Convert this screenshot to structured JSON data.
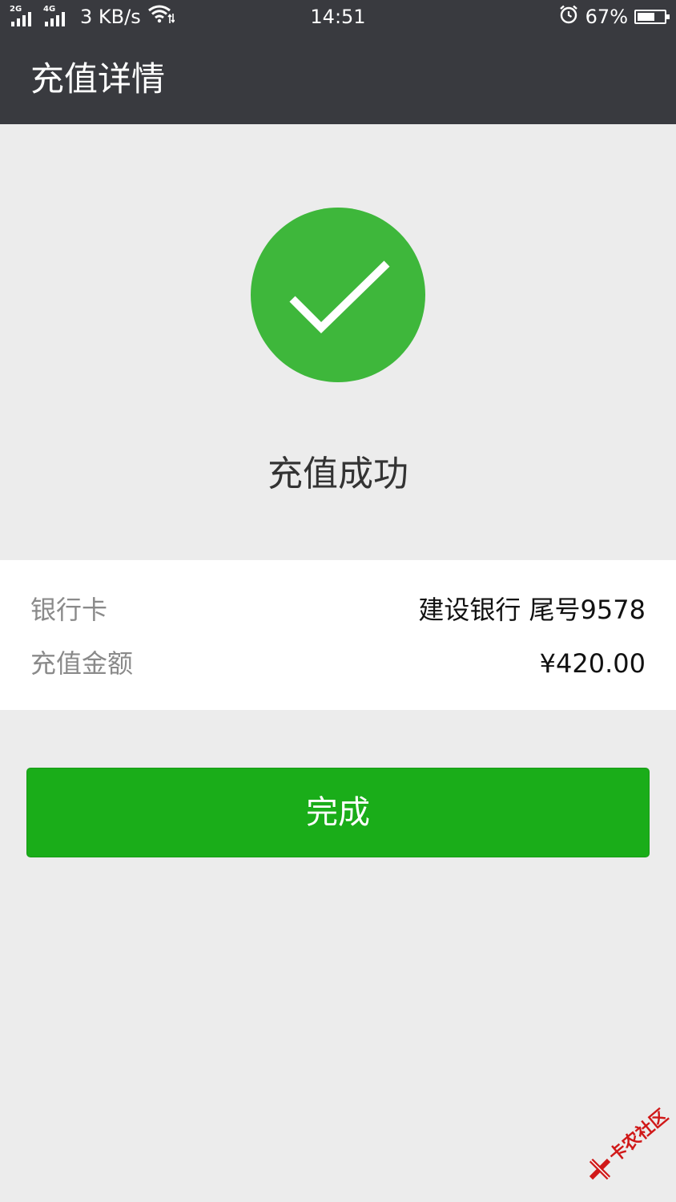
{
  "status_bar": {
    "sim1_type": "2G",
    "sim2_type": "4G",
    "net_speed": "3 KB/s",
    "time": "14:51",
    "battery_percent": "67%",
    "battery_level": 0.67,
    "icons": [
      "signal-icon",
      "wifi-icon",
      "alarm-icon",
      "battery-icon"
    ]
  },
  "header": {
    "title": "充值详情"
  },
  "result": {
    "status_text": "充值成功",
    "icon": "check-icon",
    "icon_color": "#3eb73b"
  },
  "details": [
    {
      "label": "银行卡",
      "value": "建设银行 尾号9578"
    },
    {
      "label": "充值金额",
      "value": "¥420.00"
    }
  ],
  "actions": {
    "done_label": "完成",
    "button_color": "#1aad19"
  },
  "watermark": {
    "text": "卡农社区"
  }
}
